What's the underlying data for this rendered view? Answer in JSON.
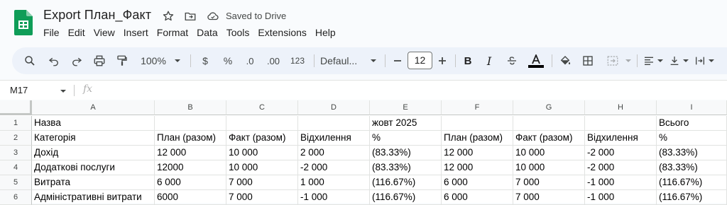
{
  "app": {
    "doc_title": "Export План_Факт",
    "save_status": "Saved to Drive"
  },
  "menu": [
    "File",
    "Edit",
    "View",
    "Insert",
    "Format",
    "Data",
    "Tools",
    "Extensions",
    "Help"
  ],
  "toolbar": {
    "zoom": "100%",
    "currency": "$",
    "percent": "%",
    "decrease_decimal": ".0",
    "increase_decimal": ".00",
    "number_format": "123",
    "font": "Defaul...",
    "font_size": "12"
  },
  "formula_bar": {
    "cell_ref": "M17",
    "fx": "fx",
    "content": ""
  },
  "columns": [
    "A",
    "B",
    "C",
    "D",
    "E",
    "F",
    "G",
    "H",
    "I"
  ],
  "rows": [
    {
      "num": "1",
      "cells": [
        "Назва",
        "",
        "",
        "",
        "жовт 2025",
        "",
        "",
        "",
        "Всього"
      ]
    },
    {
      "num": "2",
      "cells": [
        "Категорія",
        "План (разом)",
        "Факт (разом)",
        "Відхилення",
        "%",
        "План (разом)",
        "Факт (разом)",
        "Відхилення",
        "%"
      ]
    },
    {
      "num": "3",
      "cells": [
        "Дохід",
        "12 000",
        "10 000",
        "2 000",
        "(83.33%)",
        "12 000",
        "10 000",
        "-2 000",
        "(83.33%)"
      ]
    },
    {
      "num": "4",
      "cells": [
        "Додаткові послуги",
        "12000",
        "10 000",
        "-2 000",
        "(83.33%)",
        "12 000",
        "10 000",
        "-2 000",
        "(83.33%)"
      ]
    },
    {
      "num": "5",
      "cells": [
        "Витрата",
        "6 000",
        "7 000",
        "1 000",
        "(116.67%)",
        "6 000",
        "7 000",
        "-1 000",
        "(116.67%)"
      ]
    },
    {
      "num": "6",
      "cells": [
        "Адміністративні витрати",
        "6000",
        "7 000",
        "-1 000",
        "(116.67%)",
        "6 000",
        "7 000",
        "-1 000",
        "(116.67%)"
      ]
    }
  ],
  "colors": {
    "brand_green": "#0f9d58",
    "toolbar_bg": "#edf2fa"
  }
}
